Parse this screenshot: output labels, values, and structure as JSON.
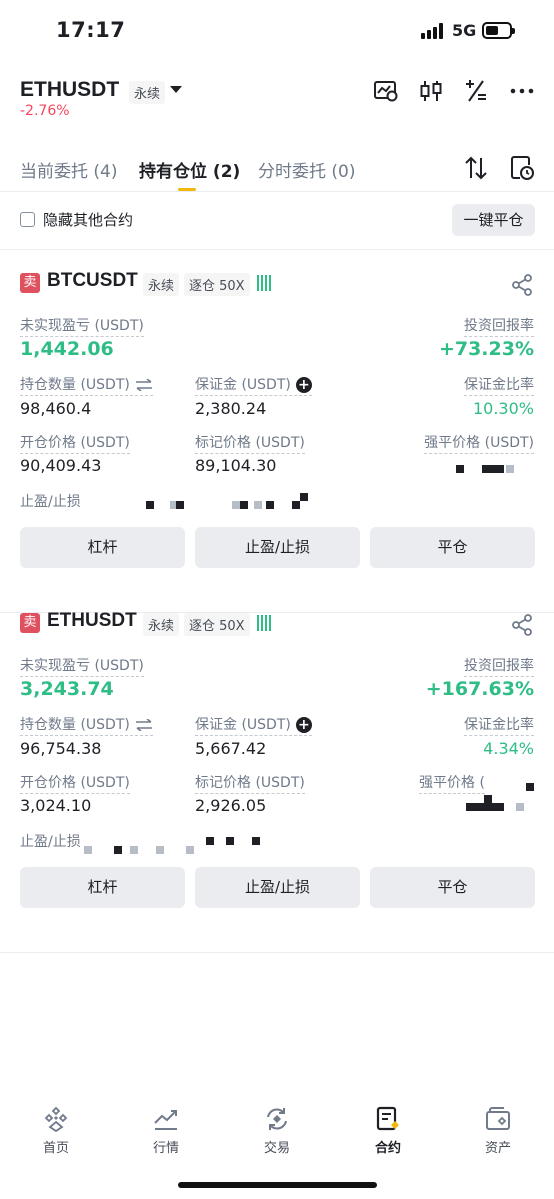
{
  "status_bar": {
    "time": "17:17",
    "network": "5G"
  },
  "header": {
    "symbol": "ETHUSDT",
    "contract_type": "永续",
    "change": "-2.76%"
  },
  "tabs": [
    {
      "label": "当前委托 (4)",
      "active": false
    },
    {
      "label": "持有仓位 (2)",
      "active": true
    },
    {
      "label": "分时委托 (0)",
      "active": false
    }
  ],
  "filter": {
    "hide_others_label": "隐藏其他合约",
    "close_all_label": "一键平仓"
  },
  "positions": [
    {
      "side": "卖",
      "symbol": "BTCUSDT",
      "contract_type": "永续",
      "margin_mode": "逐仓 50X",
      "unrealized_pnl_label": "未实现盈亏 (USDT)",
      "unrealized_pnl": "1,442.06",
      "roe_label": "投资回报率",
      "roe": "+73.23%",
      "size_label": "持仓数量 (USDT)",
      "size": "98,460.4",
      "margin_label": "保证金 (USDT)",
      "margin": "2,380.24",
      "margin_ratio_label": "保证金比率",
      "margin_ratio": "10.30%",
      "entry_label": "开仓价格 (USDT)",
      "entry": "90,409.43",
      "mark_label": "标记价格 (USDT)",
      "mark": "89,104.30",
      "liq_label": "强平价格 (USDT)",
      "tpsl_label": "止盈/止损",
      "btn_leverage": "杠杆",
      "btn_tpsl": "止盈/止损",
      "btn_close": "平仓"
    },
    {
      "side": "卖",
      "symbol": "ETHUSDT",
      "contract_type": "永续",
      "margin_mode": "逐仓 50X",
      "unrealized_pnl_label": "未实现盈亏 (USDT)",
      "unrealized_pnl": "3,243.74",
      "roe_label": "投资回报率",
      "roe": "+167.63%",
      "size_label": "持仓数量 (USDT)",
      "size": "96,754.38",
      "margin_label": "保证金 (USDT)",
      "margin": "5,667.42",
      "margin_ratio_label": "保证金比率",
      "margin_ratio": "4.34%",
      "entry_label": "开仓价格 (USDT)",
      "entry": "3,024.10",
      "mark_label": "标记价格 (USDT)",
      "mark": "2,926.05",
      "liq_label": "强平价格 (",
      "tpsl_label": "止盈/止损",
      "btn_leverage": "杠杆",
      "btn_tpsl": "止盈/止损",
      "btn_close": "平仓"
    }
  ],
  "bottom_nav": [
    {
      "label": "首页",
      "icon": "home-icon",
      "active": false
    },
    {
      "label": "行情",
      "icon": "markets-icon",
      "active": false
    },
    {
      "label": "交易",
      "icon": "trade-icon",
      "active": false
    },
    {
      "label": "合约",
      "icon": "futures-icon",
      "active": true
    },
    {
      "label": "资产",
      "icon": "wallet-icon",
      "active": false
    }
  ],
  "colors": {
    "up": "#2ebd85",
    "down": "#f6465d",
    "accent": "#f0b90b"
  }
}
